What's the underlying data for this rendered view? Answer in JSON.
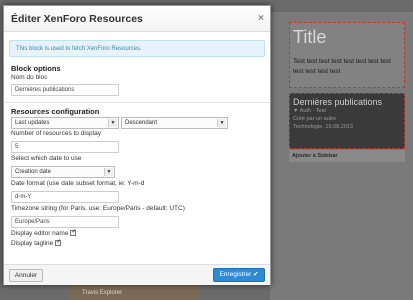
{
  "background": {
    "widget_title": "Title",
    "widget_text": "Test test test test test test test test test test test test",
    "pub_title": "Dernières publications",
    "pub_lines": [
      "▼ Auth · Test",
      "Créé par un autre",
      "Technologie, 19.08.2013"
    ],
    "sidebar_button": "Ajouter à Sidebar",
    "bottom_text": "Travis Explorer"
  },
  "modal": {
    "title": "Éditer XenForo Resources",
    "close": "×",
    "info": "This block is used to fetch XenForo Resources.",
    "block_options": {
      "heading": "Block options",
      "name_label": "Nom du bloc",
      "name_value": "Dernières publications"
    },
    "resources_config": {
      "heading": "Resources configuration",
      "order_select": "Last updates",
      "direction_select": "Descendant",
      "count_label": "Number of resources to display",
      "count_value": "5",
      "date_label": "Select which date to use",
      "date_select": "Creation date",
      "format_label": "Date format (use date subset format, ie: Y-m-d",
      "format_value": "d-m-Y",
      "timezone_label": "Timezone string (for Paris, use: Europe/Paris - default: UTC)",
      "timezone_value": "Europe/Paris",
      "editor_label": "Display editor name",
      "tagline_label": "Display tagline"
    },
    "footer": {
      "cancel": "Annuler",
      "save": "Enregistrer ✔"
    }
  }
}
